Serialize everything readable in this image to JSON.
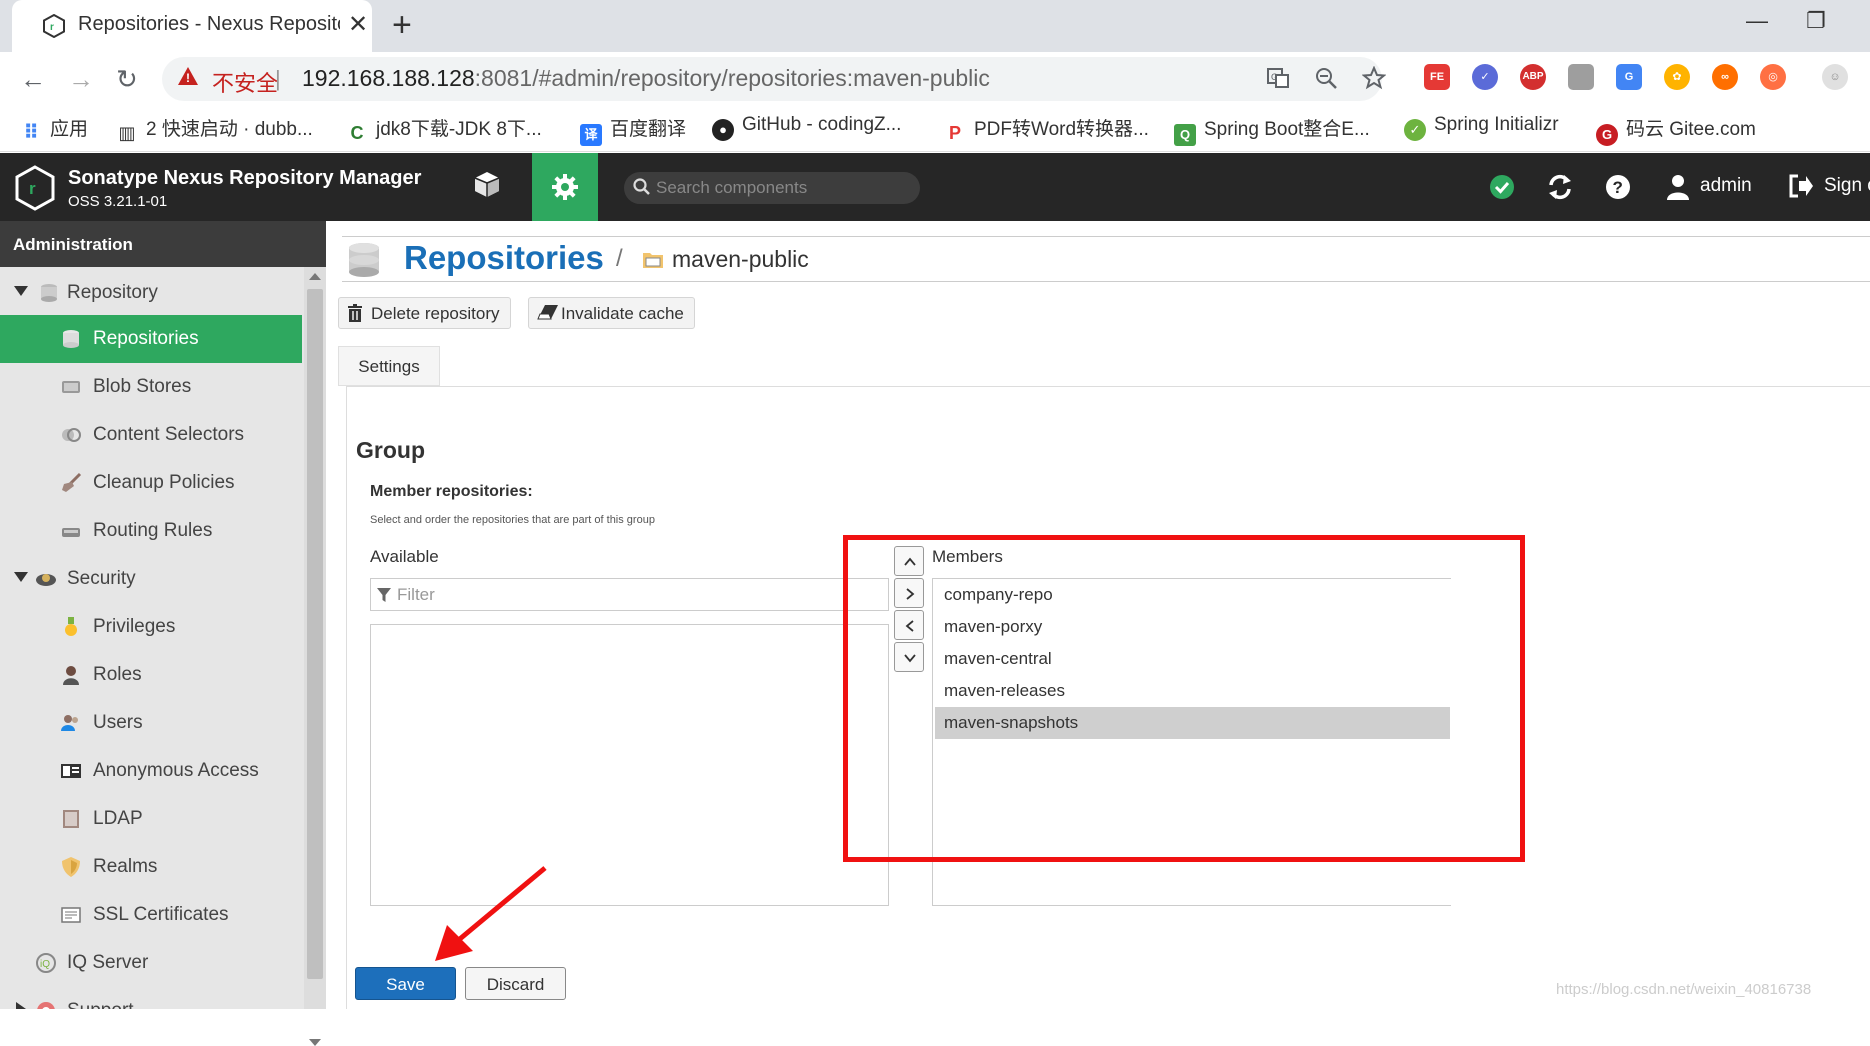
{
  "browser": {
    "tab_title": "Repositories - Nexus Repository",
    "insecure_label": "不安全",
    "url_host": "192.168.188.128",
    "url_rest": ":8081/#admin/repository/repositories:maven-public"
  },
  "bookmarks": [
    {
      "label": "应用",
      "icon": "apps-grid-icon"
    },
    {
      "label": "2 快速启动 · dubb...",
      "icon": "book-icon"
    },
    {
      "label": "jdk8下载-JDK 8下...",
      "icon": "jdk-icon"
    },
    {
      "label": "百度翻译",
      "icon": "translate-icon"
    },
    {
      "label": "GitHub - codingZ...",
      "icon": "github-icon"
    },
    {
      "label": "PDF转Word转换器...",
      "icon": "pdf-icon"
    },
    {
      "label": "Spring Boot整合E...",
      "icon": "iqiyi-icon"
    },
    {
      "label": "Spring Initializr",
      "icon": "spring-icon"
    },
    {
      "label": "码云 Gitee.com",
      "icon": "gitee-icon"
    }
  ],
  "app": {
    "title": "Sonatype Nexus Repository Manager",
    "version": "OSS 3.21.1-01",
    "search_placeholder": "Search components",
    "user": "admin",
    "signout": "Sign out"
  },
  "sidebar": {
    "title": "Administration",
    "items": [
      {
        "label": "Repository",
        "icon": "database-icon",
        "level": 0,
        "expanded": true
      },
      {
        "label": "Repositories",
        "icon": "database-icon",
        "level": 1,
        "selected": true
      },
      {
        "label": "Blob Stores",
        "icon": "blob-store-icon",
        "level": 1
      },
      {
        "label": "Content Selectors",
        "icon": "content-selector-icon",
        "level": 1
      },
      {
        "label": "Cleanup Policies",
        "icon": "broom-icon",
        "level": 1
      },
      {
        "label": "Routing Rules",
        "icon": "routing-icon",
        "level": 1
      },
      {
        "label": "Security",
        "icon": "security-icon",
        "level": 0,
        "expanded": true
      },
      {
        "label": "Privileges",
        "icon": "medal-icon",
        "level": 1
      },
      {
        "label": "Roles",
        "icon": "role-icon",
        "level": 1
      },
      {
        "label": "Users",
        "icon": "users-icon",
        "level": 1
      },
      {
        "label": "Anonymous Access",
        "icon": "id-card-icon",
        "level": 1
      },
      {
        "label": "LDAP",
        "icon": "ldap-book-icon",
        "level": 1
      },
      {
        "label": "Realms",
        "icon": "shield-icon",
        "level": 1
      },
      {
        "label": "SSL Certificates",
        "icon": "certificate-icon",
        "level": 1
      },
      {
        "label": "IQ Server",
        "icon": "iq-server-icon",
        "level": 0
      },
      {
        "label": "Support",
        "icon": "support-icon",
        "level": 0,
        "expanded": false
      }
    ]
  },
  "breadcrumb": {
    "section": "Repositories",
    "separator": "/",
    "repo": "maven-public"
  },
  "toolbar": {
    "delete_label": "Delete repository",
    "invalidate_label": "Invalidate cache"
  },
  "tabs": {
    "settings": "Settings"
  },
  "group": {
    "heading": "Group",
    "member_label": "Member repositories:",
    "member_help": "Select and order the repositories that are part of this group",
    "available_label": "Available",
    "members_label": "Members",
    "filter_placeholder": "Filter",
    "available": [],
    "members": [
      {
        "name": "company-repo",
        "selected": false
      },
      {
        "name": "maven-porxy",
        "selected": false
      },
      {
        "name": "maven-central",
        "selected": false
      },
      {
        "name": "maven-releases",
        "selected": false
      },
      {
        "name": "maven-snapshots",
        "selected": true
      }
    ]
  },
  "actions": {
    "save_label": "Save",
    "discard_label": "Discard"
  },
  "watermark": "https://blog.csdn.net/weixin_40816738",
  "colors": {
    "accent_green": "#2ea85f",
    "header_dark": "#262626",
    "title_blue": "#1a6fb7",
    "save_blue": "#1d6fbb",
    "annotation_red": "#f01111"
  }
}
